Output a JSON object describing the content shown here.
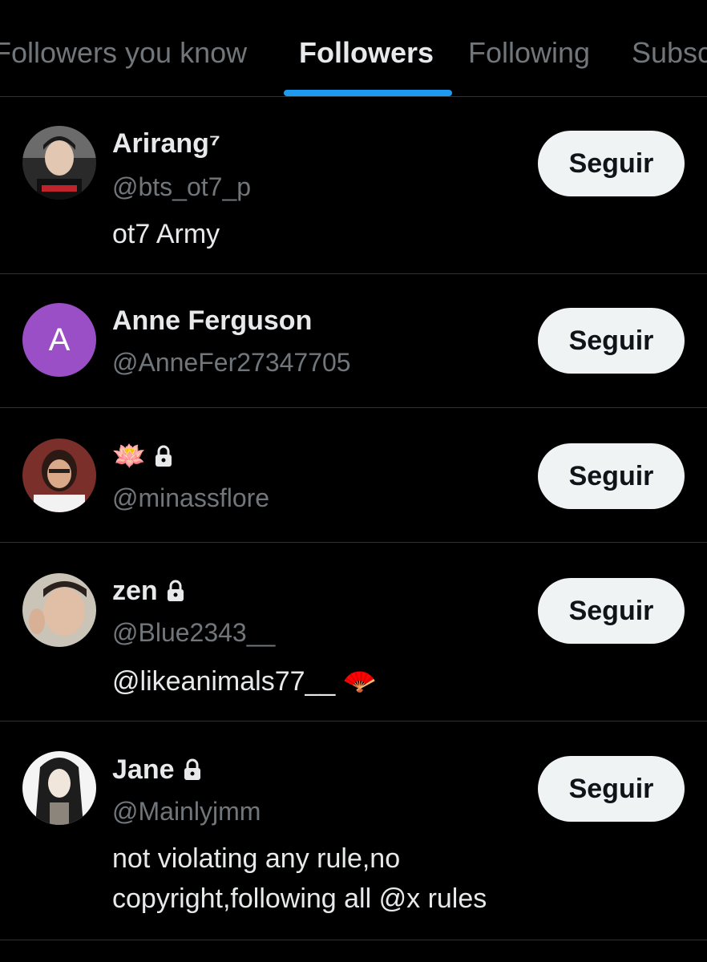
{
  "tabs": [
    {
      "label": "Followers you know",
      "active": false
    },
    {
      "label": "Followers",
      "active": true
    },
    {
      "label": "Following",
      "active": false
    },
    {
      "label": "Subscriptions",
      "active": false
    }
  ],
  "accent_color": "#1d9bf0",
  "follow_label": "Seguir",
  "users": [
    {
      "name": "Arirang⁷",
      "handle": "@bts_ot7_p",
      "bio": "ot7 Army",
      "locked": false,
      "avatar": "photo"
    },
    {
      "name": "Anne Ferguson",
      "handle": "@AnneFer27347705",
      "bio": "",
      "locked": false,
      "avatar": "letter",
      "avatar_letter": "A",
      "avatar_color": "#9b59b6"
    },
    {
      "name": "🪷",
      "handle": "@minassflore",
      "bio": "",
      "locked": true,
      "avatar": "photo"
    },
    {
      "name": "zen",
      "handle": "@Blue2343__",
      "bio": "@likeanimals77__ 🪭",
      "locked": true,
      "avatar": "photo"
    },
    {
      "name": "Jane",
      "handle": "@Mainlyjmm",
      "bio": "not violating any rule,no copyright,following all @x rules",
      "locked": true,
      "avatar": "illustration"
    }
  ]
}
